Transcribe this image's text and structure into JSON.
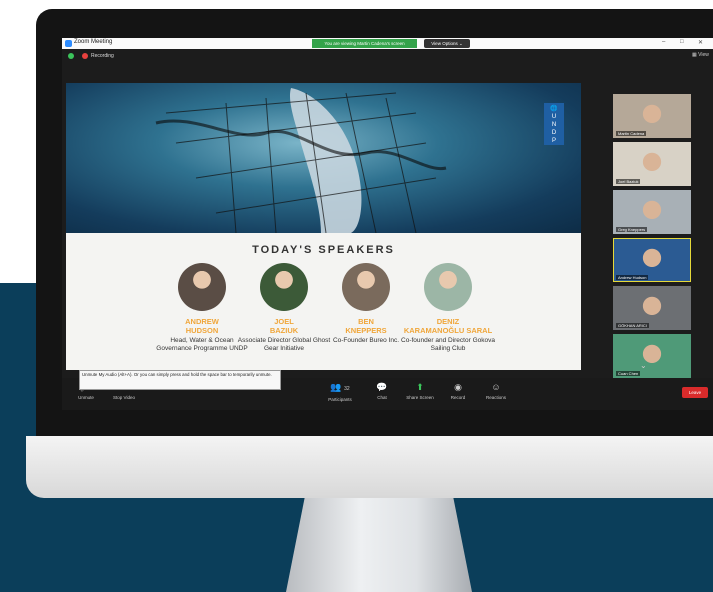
{
  "window": {
    "title": "Zoom Meeting",
    "share_banner": "You are viewing Martin Cadena's screen",
    "view_options": "View Options ⌄",
    "controls": [
      "–",
      "□",
      "✕"
    ],
    "recording_label": "Recording",
    "view_label": "▦ View"
  },
  "slide": {
    "logo_lines": [
      "🌐",
      "U",
      "N",
      "D",
      "P"
    ],
    "title": "TODAY'S SPEAKERS",
    "speakers": [
      {
        "name_line1": "ANDREW",
        "name_line2": "HUDSON",
        "role": "Head, Water & Ocean Governance Programme UNDP",
        "photo_color": "#5a4d45"
      },
      {
        "name_line1": "JOEL",
        "name_line2": "BAZIUK",
        "role": "Associate Director Global Ghost Gear Initiative",
        "photo_color": "#3c5a38"
      },
      {
        "name_line1": "BEN",
        "name_line2": "KNEPPERS",
        "role": "Co-Founder Bureo Inc.",
        "photo_color": "#7a6a5c"
      },
      {
        "name_line1": "DENIZ",
        "name_line2": "KARAMANOĞLU SARAL",
        "role": "Co-founder and Director Gokova Sailing Club",
        "photo_color": "#9cb6a6"
      }
    ]
  },
  "gallery": {
    "participants": [
      {
        "name": "Martin Cadena",
        "bg": "#b5a898",
        "active": false
      },
      {
        "name": "Joel Baziuk",
        "bg": "#d8d2c6",
        "active": false
      },
      {
        "name": "Greg Kneppers",
        "bg": "#a8b0b6",
        "active": false
      },
      {
        "name": "Andrew Hudson",
        "bg": "#2b5b93",
        "active": true
      },
      {
        "name": "GÖKHAN ARICI",
        "bg": "#6c6f73",
        "active": false
      },
      {
        "name": "Cuan Chen",
        "bg": "#4f9a78",
        "active": false
      }
    ],
    "more_chevron": "⌄"
  },
  "toolbar": {
    "items": [
      {
        "label": "Unmute",
        "icon": "🎤",
        "name": "microphone"
      },
      {
        "label": "Stop Video",
        "icon": "■",
        "name": "video-camera"
      },
      {
        "label": "Participants",
        "icon": "👥",
        "name": "participants",
        "count": "32"
      },
      {
        "label": "Chat",
        "icon": "💬",
        "name": "chat"
      },
      {
        "label": "Share Screen",
        "icon": "⬆",
        "name": "share-screen"
      },
      {
        "label": "Record",
        "icon": "◉",
        "name": "record"
      },
      {
        "label": "Reactions",
        "icon": "☺",
        "name": "reactions"
      }
    ],
    "leave_label": "Leave",
    "tooltip": "Unmute My Audio (Alt+A). Or you can simply press and hold the space bar to temporarily unmute."
  }
}
